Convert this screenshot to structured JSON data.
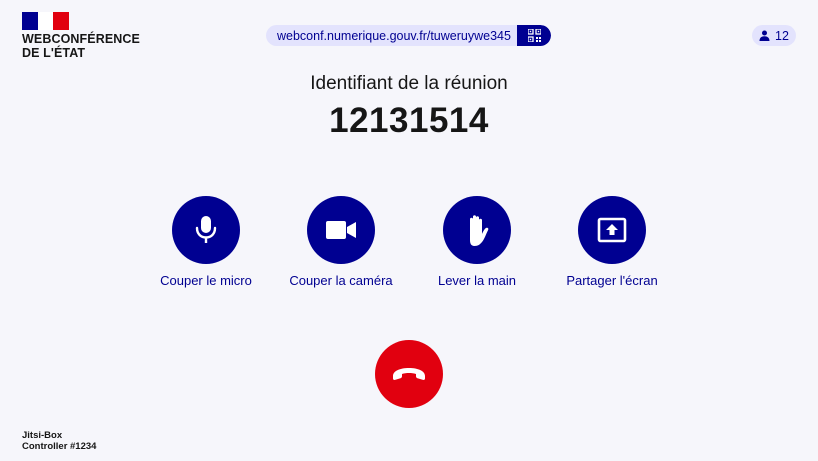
{
  "brand": {
    "line1": "WEBCONFÉRENCE",
    "line2": "DE L'ÉTAT",
    "colors": {
      "blue": "#000091",
      "white": "#ffffff",
      "red": "#e1000f"
    }
  },
  "header": {
    "url": "webconf.numerique.gouv.fr/tuweruywe345",
    "qr_icon": "qr-code-icon",
    "participants_icon": "person-icon",
    "participants_count": "12"
  },
  "meeting": {
    "label": "Identifiant de la réunion",
    "id": "12131514"
  },
  "controls": [
    {
      "icon": "microphone-icon",
      "label": "Couper le micro"
    },
    {
      "icon": "video-camera-icon",
      "label": "Couper la caméra"
    },
    {
      "icon": "raise-hand-icon",
      "label": "Lever la main"
    },
    {
      "icon": "share-screen-icon",
      "label": "Partager l'écran"
    }
  ],
  "hangup": {
    "icon": "hang-up-phone-icon",
    "color": "#e1000f"
  },
  "footer": {
    "line1": "Jitsi-Box",
    "line2": "Controller #1234"
  }
}
